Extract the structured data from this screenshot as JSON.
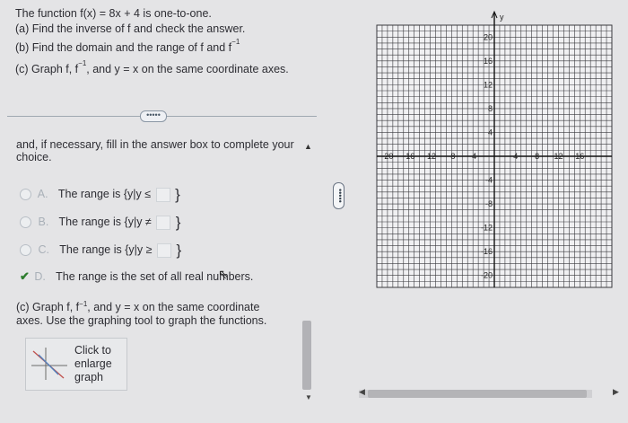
{
  "question": {
    "line1": "The function f(x) = 8x + 4 is one-to-one.",
    "line2": "(a) Find the inverse of f and check the answer.",
    "line3_pre": "(b) Find the domain and the range of f and f",
    "line3_sup": "−1",
    "line4_pre": "(c) Graph f, f",
    "line4_sup": "−1",
    "line4_post": ", and y = x on the same coordinate axes."
  },
  "more_button": "•••••",
  "instruction": "and, if necessary, fill in the answer box to complete your choice.",
  "options": [
    {
      "letter": "A.",
      "text": "The range is",
      "set_open": "{y|y ≤",
      "set_close": "}",
      "selected": false
    },
    {
      "letter": "B.",
      "text": "The range is",
      "set_open": "{y|y ≠",
      "set_close": "}",
      "selected": false
    },
    {
      "letter": "C.",
      "text": "The range is",
      "set_open": "{y|y ≥",
      "set_close": "}",
      "selected": false
    },
    {
      "letter": "D.",
      "text": "The range is the set of all real numbers.",
      "selected": true
    }
  ],
  "graph_note": {
    "pre": "(c) Graph f, f",
    "sup": "−1",
    "post": ", and y = x on the same coordinate axes. Use the graphing tool to graph the functions."
  },
  "enlarge": {
    "line1": "Click to",
    "line2": "enlarge",
    "line3": "graph"
  },
  "panel_handle": "•••••",
  "graph": {
    "axis_label_y": "y",
    "x_ticks": [
      "-20",
      "-16",
      "-12",
      "-8",
      "-4",
      "4",
      "8",
      "12",
      "16"
    ],
    "y_ticks": [
      "20",
      "16",
      "12",
      "8",
      "4",
      "-4",
      "-8",
      "-12",
      "-16",
      "-20"
    ],
    "colors": {
      "grid": "#3a3a3e",
      "background": "#f0f0f2",
      "axis": "#111111"
    }
  }
}
